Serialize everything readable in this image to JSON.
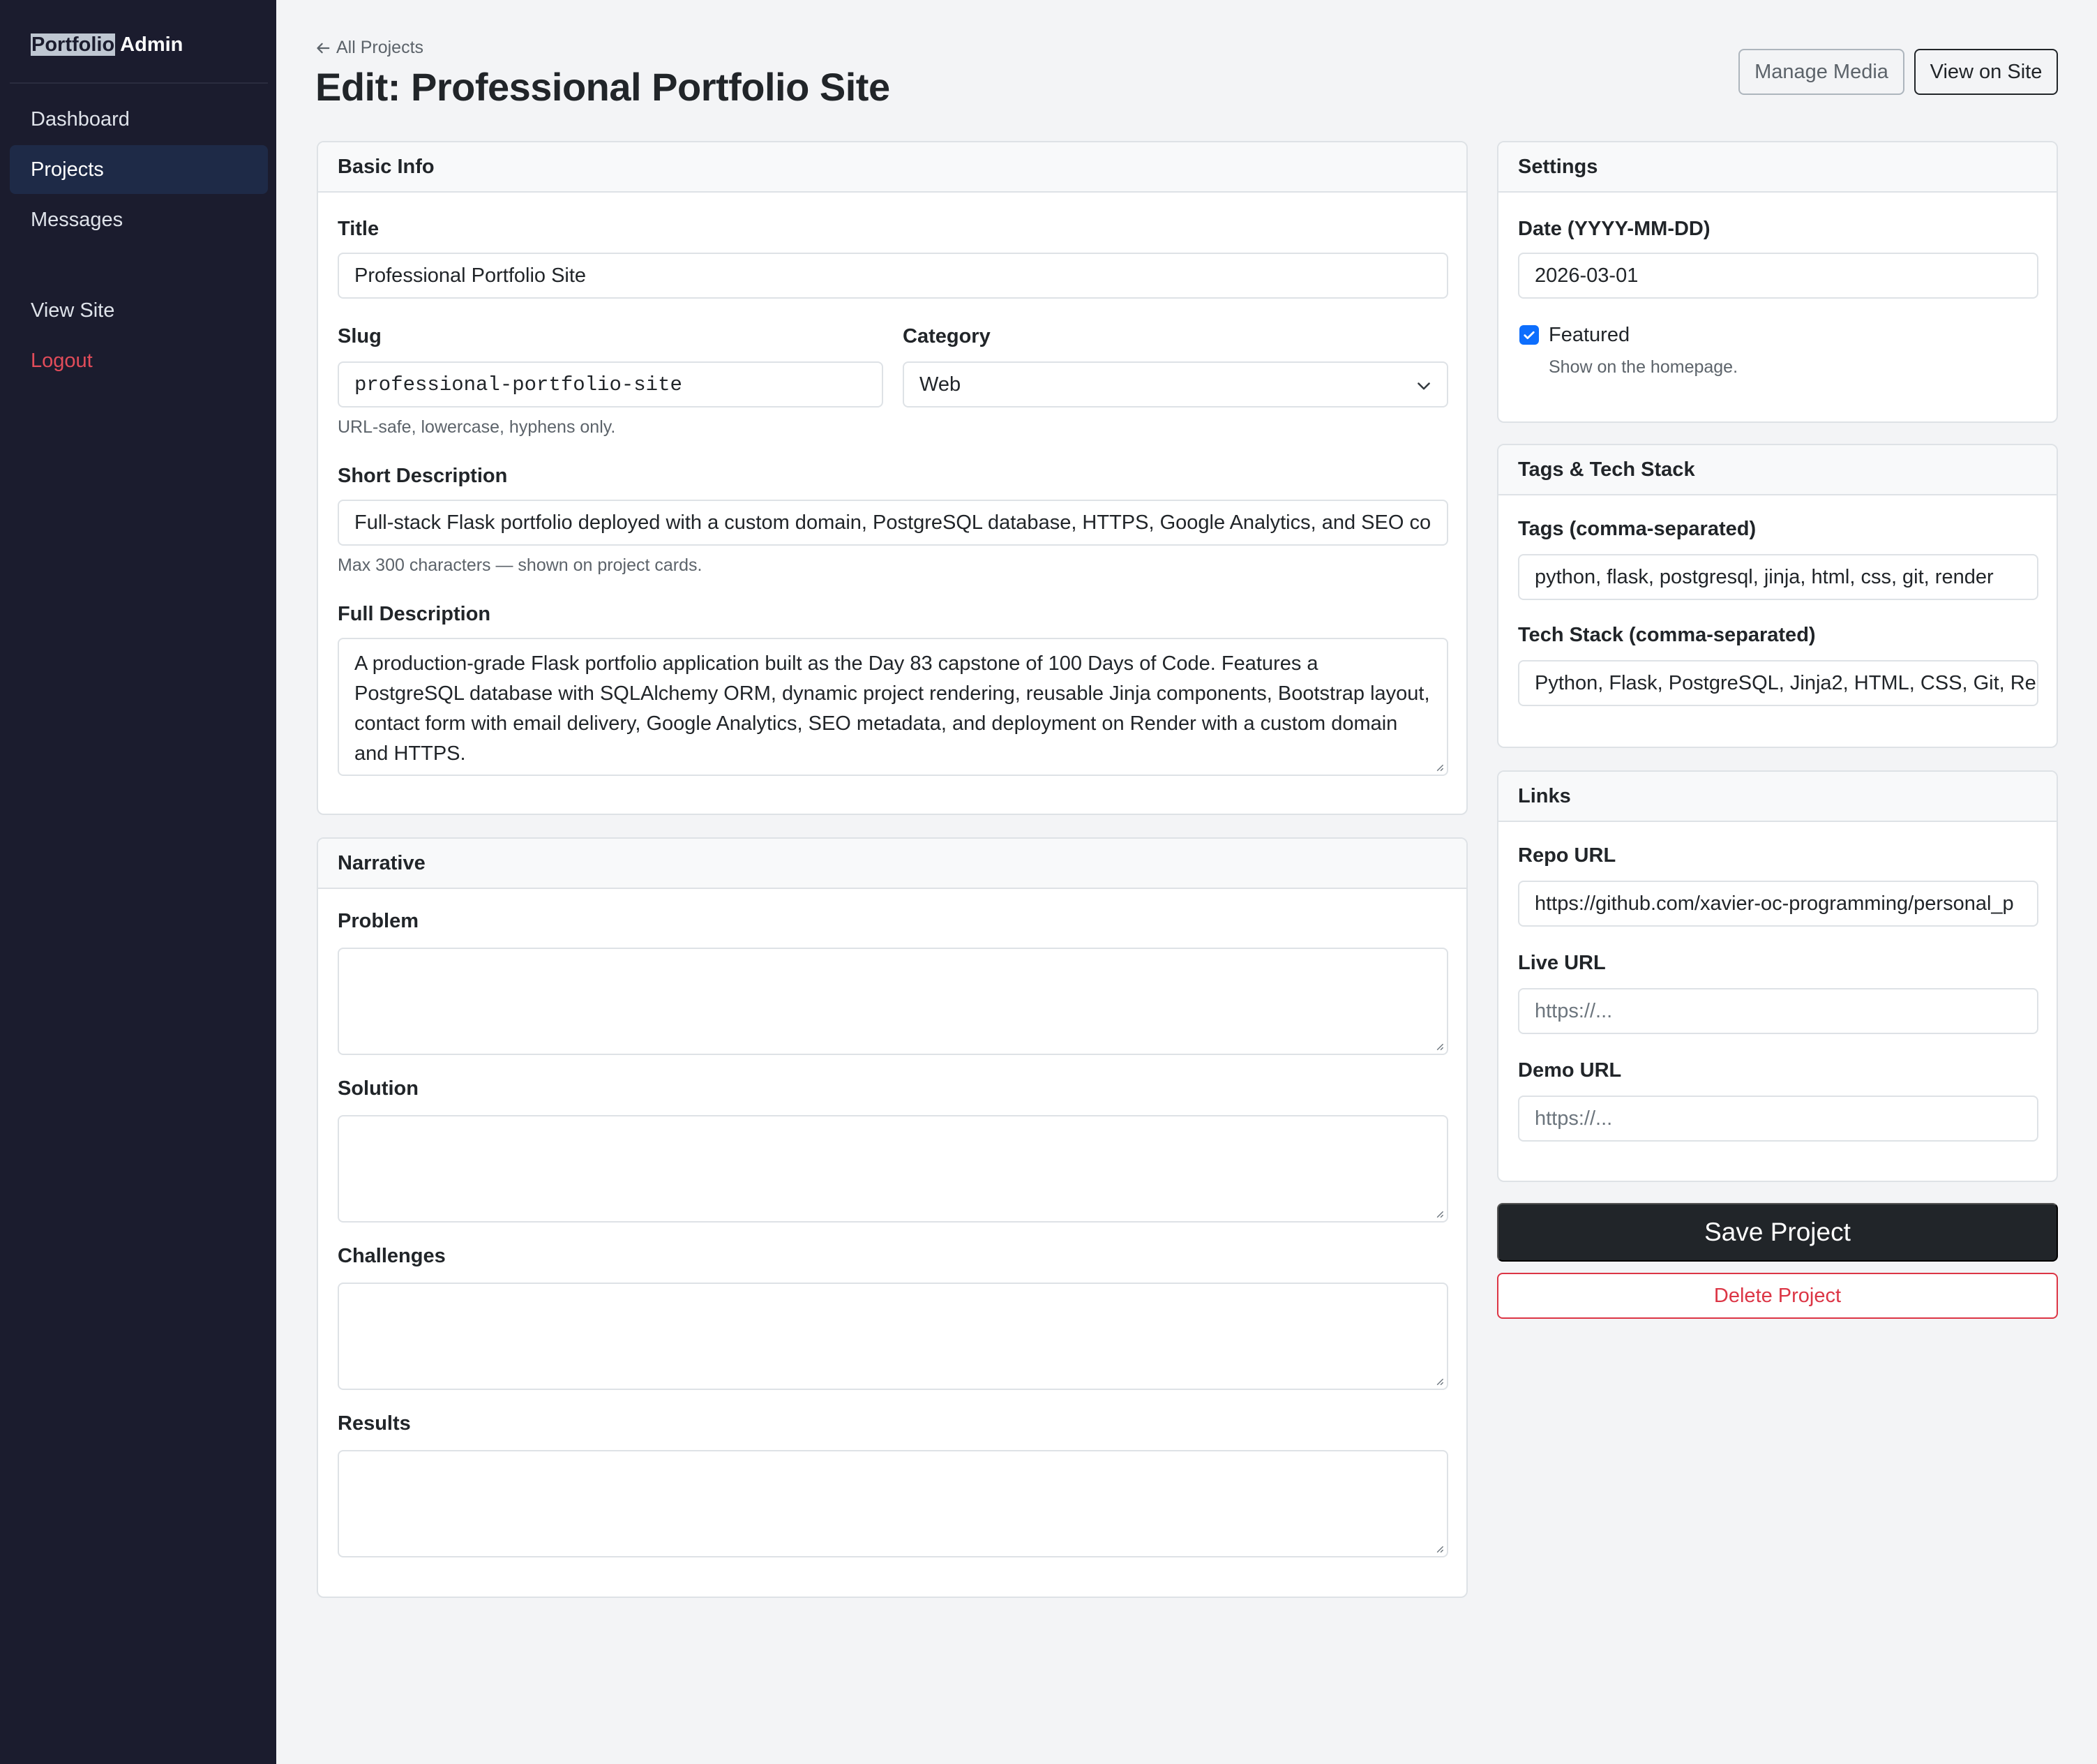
{
  "brand": {
    "part1": "Portfolio",
    "part2": " Admin"
  },
  "nav": {
    "dashboard": "Dashboard",
    "projects": "Projects",
    "messages": "Messages",
    "view_site": "View Site",
    "logout": "Logout"
  },
  "header": {
    "back_link": "All Projects",
    "title": "Edit: Professional Portfolio Site",
    "manage_media": "Manage Media",
    "view_on_site": "View on Site"
  },
  "basic_info": {
    "header": "Basic Info",
    "title_label": "Title",
    "title_value": "Professional Portfolio Site",
    "slug_label": "Slug",
    "slug_value": "professional-portfolio-site",
    "slug_help": "URL-safe, lowercase, hyphens only.",
    "category_label": "Category",
    "category_value": "Web",
    "short_label": "Short Description",
    "short_value": "Full-stack Flask portfolio deployed with a custom domain, PostgreSQL database, HTTPS, Google Analytics, and SEO co",
    "short_help": "Max 300 characters — shown on project cards.",
    "full_label": "Full Description",
    "full_value": "A production-grade Flask portfolio application built as the Day 83 capstone of 100 Days of Code. Features a PostgreSQL database with SQLAlchemy ORM, dynamic project rendering, reusable Jinja components, Bootstrap layout, contact form with email delivery, Google Analytics, SEO metadata, and deployment on Render with a custom domain and HTTPS."
  },
  "narrative": {
    "header": "Narrative",
    "problem_label": "Problem",
    "problem_value": "",
    "solution_label": "Solution",
    "solution_value": "",
    "challenges_label": "Challenges",
    "challenges_value": "",
    "results_label": "Results",
    "results_value": ""
  },
  "settings": {
    "header": "Settings",
    "date_label": "Date (YYYY-MM-DD)",
    "date_value": "2026-03-01",
    "featured_label": "Featured",
    "featured_checked": true,
    "featured_help": "Show on the homepage."
  },
  "tags": {
    "header": "Tags & Tech Stack",
    "tags_label": "Tags (comma-separated)",
    "tags_value": "python, flask, postgresql, jinja, html, css, git, render",
    "tech_label": "Tech Stack (comma-separated)",
    "tech_value": "Python, Flask, PostgreSQL, Jinja2, HTML, CSS, Git, Re"
  },
  "links": {
    "header": "Links",
    "repo_label": "Repo URL",
    "repo_value": "https://github.com/xavier-oc-programming/personal_p",
    "live_label": "Live URL",
    "live_placeholder": "https://...",
    "demo_label": "Demo URL",
    "demo_placeholder": "https://..."
  },
  "actions": {
    "save": "Save Project",
    "delete": "Delete Project"
  },
  "colors": {
    "sidebar_bg": "#1b1c2e",
    "active_nav": "#1e2a47",
    "logout": "#e24c5a",
    "primary_dark": "#212529",
    "danger": "#dc3545",
    "checkbox": "#0d6efd"
  }
}
